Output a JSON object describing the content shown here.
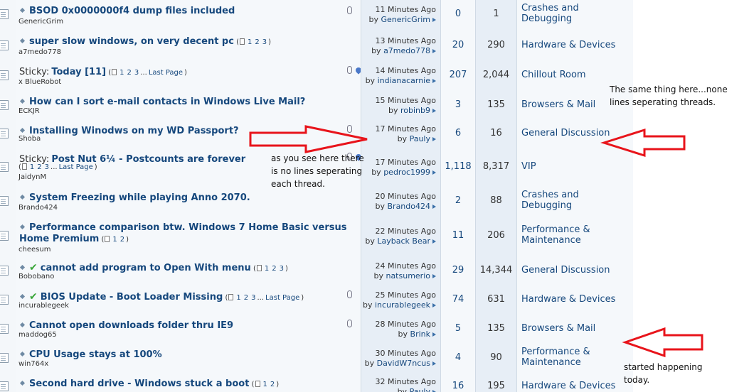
{
  "threads": [
    {
      "title": "BSOD 0x0000000f4 dump files included",
      "starter": "GenericGrim",
      "time": "11 Minutes Ago",
      "last_by": "GenericGrim",
      "replies": "0",
      "views": "1",
      "forum": "Crashes and Debugging",
      "attachment": true
    },
    {
      "title": "super slow windows, on very decent pc",
      "starter": "a7medo778",
      "pages": [
        "1",
        "2",
        "3"
      ],
      "time": "13 Minutes Ago",
      "last_by": "a7medo778",
      "replies": "20",
      "views": "290",
      "forum": "Hardware & Devices"
    },
    {
      "prefix": "Sticky:",
      "title": "Today [11]",
      "starter": "x BlueRobot",
      "pages": [
        "1",
        "2",
        "3"
      ],
      "dots": "...",
      "last_page": "Last Page",
      "time": "14 Minutes Ago",
      "last_by": "indianacarnie",
      "replies": "207",
      "views": "2,044",
      "forum": "Chillout Room",
      "attachment": true,
      "sticky": true
    },
    {
      "title": "How can I sort e-mail contacts in Windows Live Mail?",
      "starter": "ECKJR",
      "time": "15 Minutes Ago",
      "last_by": "robinb9",
      "replies": "3",
      "views": "135",
      "forum": "Browsers & Mail"
    },
    {
      "title": "Installing Winodws on my WD Passport?",
      "starter": "Shoba",
      "time": "17 Minutes Ago",
      "last_by": "Pauly",
      "replies": "6",
      "views": "16",
      "forum": "General Discussion",
      "attachment": true
    },
    {
      "prefix": "Sticky:",
      "title": "Post Nut 6¼ - Postcounts are forever",
      "starter": "JaidynM",
      "pages": [
        "1",
        "2",
        "3"
      ],
      "dots": "...",
      "last_page": "Last Page",
      "time": "17 Minutes Ago",
      "last_by": "pedroc1999",
      "replies": "1,118",
      "views": "8,317",
      "forum": "VIP",
      "attachment": true,
      "sticky": true
    },
    {
      "title": "System Freezing while playing Anno 2070.",
      "starter": "Brando424",
      "time": "20 Minutes Ago",
      "last_by": "Brando424",
      "replies": "2",
      "views": "88",
      "forum": "Crashes and Debugging"
    },
    {
      "title": "Performance comparison btw. Windows 7 Home Basic versus Home Premium",
      "starter": "cheesum",
      "pages": [
        "1",
        "2"
      ],
      "time": "22 Minutes Ago",
      "last_by": "Layback Bear",
      "replies": "11",
      "views": "206",
      "forum": "Performance & Maintenance"
    },
    {
      "title": "cannot add program to Open With menu",
      "starter": "Bobobano",
      "pages": [
        "1",
        "2",
        "3"
      ],
      "time": "24 Minutes Ago",
      "last_by": "natsumerio",
      "replies": "29",
      "views": "14,344",
      "forum": "General Discussion",
      "solved": true
    },
    {
      "title": "BIOS Update - Boot Loader Missing",
      "starter": "incurablegeek",
      "pages": [
        "1",
        "2",
        "3"
      ],
      "dots": "...",
      "last_page": "Last Page",
      "time": "25 Minutes Ago",
      "last_by": "incurablegeek",
      "replies": "74",
      "views": "631",
      "forum": "Hardware & Devices",
      "solved": true,
      "attachment": true
    },
    {
      "title": "Cannot open downloads folder thru IE9",
      "starter": "maddog65",
      "time": "28 Minutes Ago",
      "last_by": "Brink",
      "replies": "5",
      "views": "135",
      "forum": "Browsers & Mail",
      "attachment": true
    },
    {
      "title": "CPU Usage stays at 100%",
      "starter": "win764x",
      "time": "30 Minutes Ago",
      "last_by": "DavidW7ncus",
      "replies": "4",
      "views": "90",
      "forum": "Performance & Maintenance"
    },
    {
      "title": "Second hard drive - Windows stuck a boot",
      "starter": "",
      "pages": [
        "1",
        "2"
      ],
      "time": "32 Minutes Ago",
      "last_by": "Pauly",
      "replies": "16",
      "views": "195",
      "forum": "Hardware & Devices"
    }
  ],
  "annotations": {
    "note_1": "as you see here there is no lines seperating each thread.",
    "note_2": "The same thing here...none lines seperating threads.",
    "note_3": "started happening today."
  },
  "colors": {
    "link": "#16487d",
    "arrow": "#e8141b",
    "row_alt": "#e7eef6",
    "row": "#f5f8fb"
  }
}
